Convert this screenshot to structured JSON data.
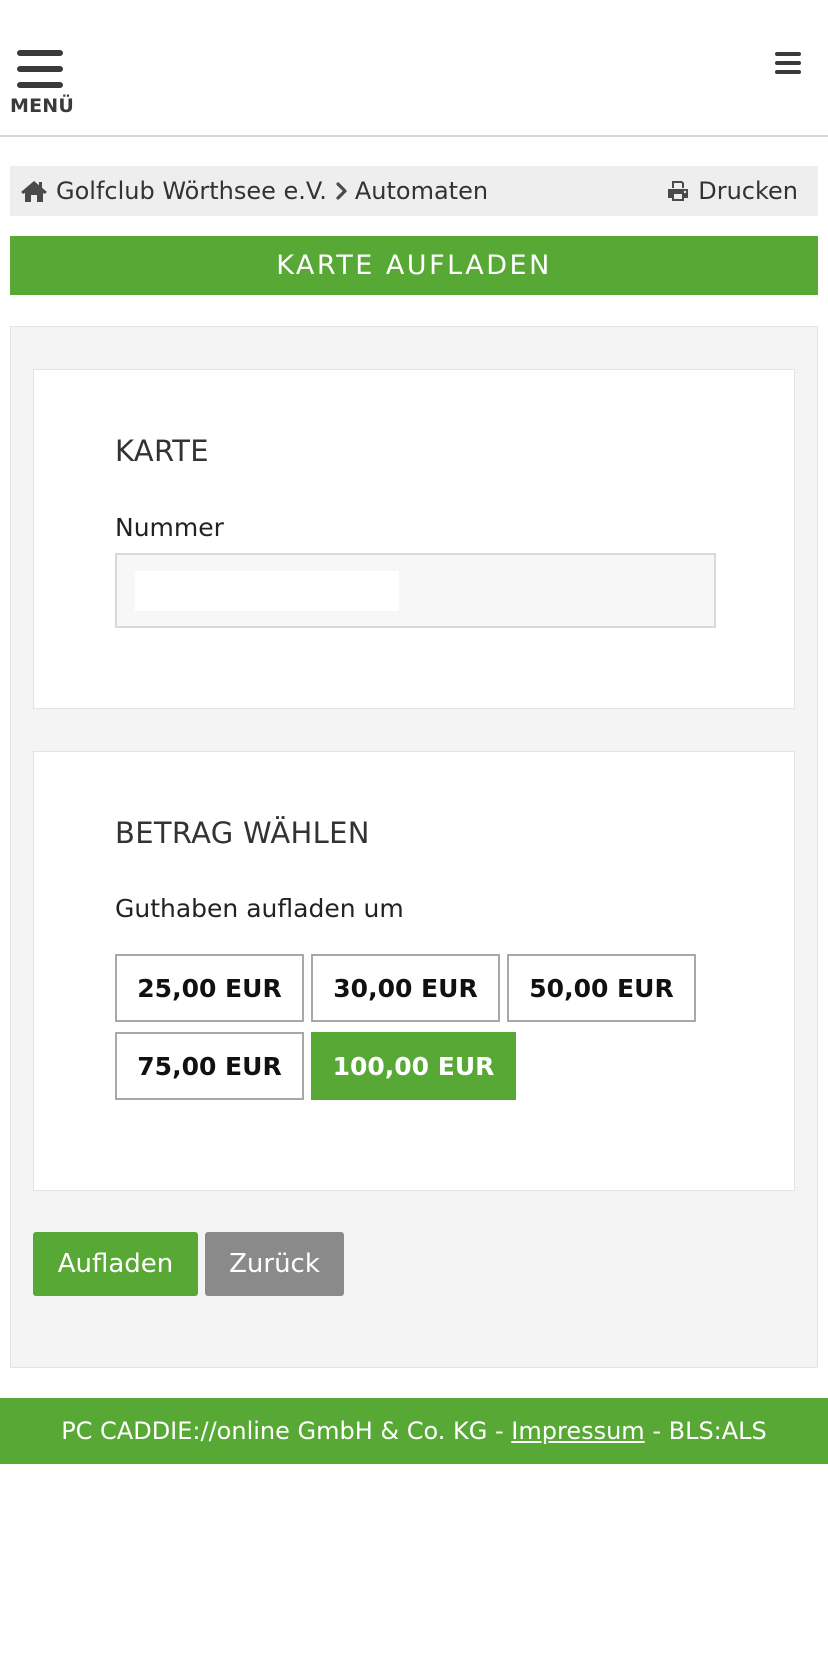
{
  "header": {
    "menu_label": "MENÜ",
    "menu_icon": "hamburger-icon",
    "right_menu_icon": "hamburger-icon"
  },
  "breadcrumb": {
    "home_icon": "home-icon",
    "club": "Golfclub Wörthsee e.V.",
    "separator_icon": "chevron-right-icon",
    "current": "Automaten",
    "print_icon": "printer-icon",
    "print_label": "Drucken"
  },
  "page": {
    "title": "KARTE AUFLADEN"
  },
  "karte": {
    "heading": "KARTE",
    "number_label": "Nummer",
    "number_value": ""
  },
  "betrag": {
    "heading": "BETRAG WÄHLEN",
    "label": "Guthaben aufladen um",
    "options": [
      "25,00 EUR",
      "30,00 EUR",
      "50,00 EUR",
      "75,00 EUR",
      "100,00 EUR"
    ],
    "selected": "100,00 EUR"
  },
  "actions": {
    "submit_label": "Aufladen",
    "back_label": "Zurück"
  },
  "footer": {
    "company": "PC CADDIE://online GmbH & Co. KG - ",
    "impressum": "Impressum",
    "suffix": " - BLS:ALS"
  },
  "colors": {
    "accent": "#57a834",
    "secondary_button": "#8a8a8a",
    "panel_background": "#f4f4f4"
  }
}
